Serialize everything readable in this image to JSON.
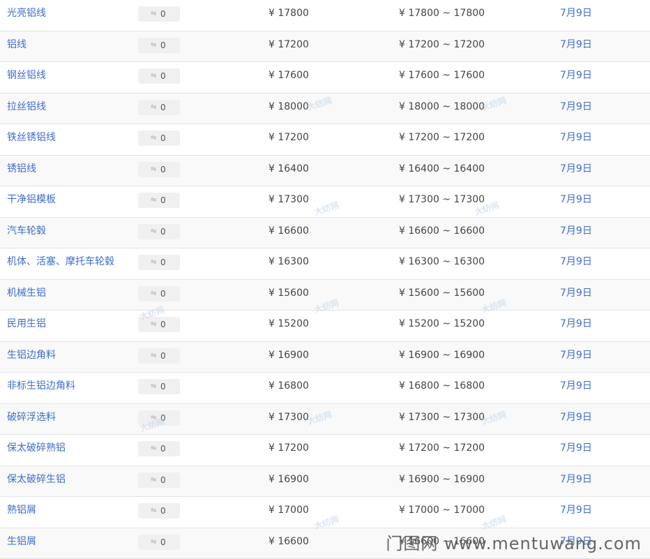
{
  "currency_symbol": "¥",
  "change_icon": "trend-icon",
  "colors": {
    "link": "#3f6dcb",
    "row_alt": "#f9f9f9",
    "divider": "#e3e3e3"
  },
  "rows": [
    {
      "name": "光亮铝线",
      "change": "0",
      "price": "¥ 17800",
      "range": "¥ 17800 ~ 17800",
      "date": "7月9日"
    },
    {
      "name": "铝线",
      "change": "0",
      "price": "¥ 17200",
      "range": "¥ 17200 ~ 17200",
      "date": "7月9日"
    },
    {
      "name": "钢丝铝线",
      "change": "0",
      "price": "¥ 17600",
      "range": "¥ 17600 ~ 17600",
      "date": "7月9日"
    },
    {
      "name": "拉丝铝线",
      "change": "0",
      "price": "¥ 18000",
      "range": "¥ 18000 ~ 18000",
      "date": "7月9日"
    },
    {
      "name": "铁丝锈铝线",
      "change": "0",
      "price": "¥ 17200",
      "range": "¥ 17200 ~ 17200",
      "date": "7月9日"
    },
    {
      "name": "锈铝线",
      "change": "0",
      "price": "¥ 16400",
      "range": "¥ 16400 ~ 16400",
      "date": "7月9日"
    },
    {
      "name": "干净铝模板",
      "change": "0",
      "price": "¥ 17300",
      "range": "¥ 17300 ~ 17300",
      "date": "7月9日"
    },
    {
      "name": "汽车轮毂",
      "change": "0",
      "price": "¥ 16600",
      "range": "¥ 16600 ~ 16600",
      "date": "7月9日"
    },
    {
      "name": "机体、活塞、摩托车轮毂",
      "change": "0",
      "price": "¥ 16300",
      "range": "¥ 16300 ~ 16300",
      "date": "7月9日"
    },
    {
      "name": "机械生铝",
      "change": "0",
      "price": "¥ 15600",
      "range": "¥ 15600 ~ 15600",
      "date": "7月9日"
    },
    {
      "name": "民用生铝",
      "change": "0",
      "price": "¥ 15200",
      "range": "¥ 15200 ~ 15200",
      "date": "7月9日"
    },
    {
      "name": "生铝边角料",
      "change": "0",
      "price": "¥ 16900",
      "range": "¥ 16900 ~ 16900",
      "date": "7月9日"
    },
    {
      "name": "非标生铝边角料",
      "change": "0",
      "price": "¥ 16800",
      "range": "¥ 16800 ~ 16800",
      "date": "7月9日"
    },
    {
      "name": "破碎浮选料",
      "change": "0",
      "price": "¥ 17300",
      "range": "¥ 17300 ~ 17300",
      "date": "7月9日"
    },
    {
      "name": "保太破碎熟铝",
      "change": "0",
      "price": "¥ 17200",
      "range": "¥ 17200 ~ 17200",
      "date": "7月9日"
    },
    {
      "name": "保太破碎生铝",
      "change": "0",
      "price": "¥ 16900",
      "range": "¥ 16900 ~ 16900",
      "date": "7月9日"
    },
    {
      "name": "熟铝屑",
      "change": "0",
      "price": "¥ 17000",
      "range": "¥ 17000 ~ 17000",
      "date": "7月9日"
    },
    {
      "name": "生铝屑",
      "change": "0",
      "price": "¥ 16600",
      "range": "¥ 16600 ~ 16600",
      "date": "7月9日"
    }
  ],
  "watermark": "大纺网",
  "footer_watermark": "门图网 www.mentuwang.com"
}
